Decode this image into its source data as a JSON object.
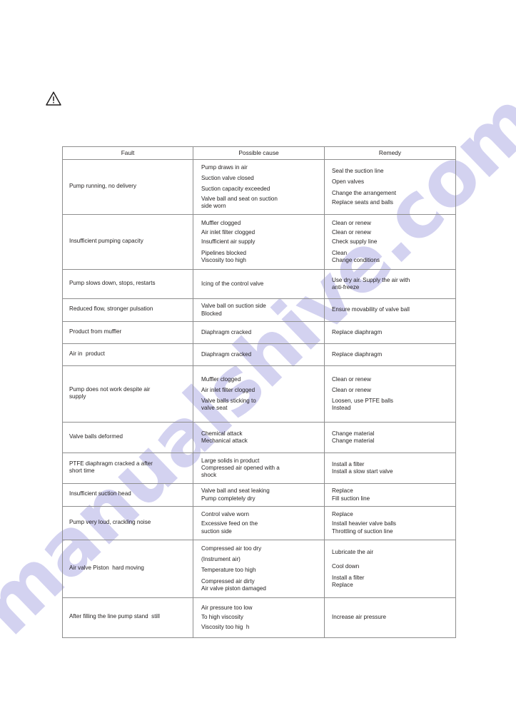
{
  "page": {
    "background_color": "#ffffff",
    "text_color": "#221f1f",
    "border_color": "#8e8e8e"
  },
  "watermark": {
    "text": "manualshive.com",
    "color": "#b9b7e8"
  },
  "warning_icon": {
    "name": "warning-triangle-icon",
    "glyph": "⚠"
  },
  "table": {
    "headers": [
      "Fault",
      "Possible cause",
      "Remedy"
    ],
    "rows": [
      {
        "fault": [
          "Pump running, no delivery"
        ],
        "cause": [
          "Pump draws in air",
          "Suction valve closed",
          "Suction capacity exceeded",
          "Valve ball and seat on suction",
          "side worn"
        ],
        "remedy": [
          "Seal the suction line",
          "Open valves",
          "Change the arrangement",
          "Replace seats and balls"
        ]
      },
      {
        "fault": [
          "Insufficient pumping capacity"
        ],
        "cause": [
          "Muffler clogged",
          "Air inlet filter clogged",
          "Insufficient air supply",
          "Pipelines blocked",
          "Viscosity too high"
        ],
        "remedy": [
          "Clean or renew",
          "Clean or renew",
          "Check supply line",
          "Clean",
          "Change conditions"
        ]
      },
      {
        "fault": [
          "Pump slows down, stops, restarts"
        ],
        "cause": [
          "Icing of the control valve"
        ],
        "remedy": [
          "Use dry air. Supply the air with",
          "anti-freeze"
        ]
      },
      {
        "fault": [
          "Reduced flow, stronger pulsation"
        ],
        "cause": [
          "Valve ball on suction side",
          "Blocked"
        ],
        "remedy": [
          "Ensure movability of valve ball"
        ]
      },
      {
        "fault": [
          "Product from muffler"
        ],
        "cause": [
          "Diaphragm cracked"
        ],
        "remedy": [
          "Replace diaphragm"
        ]
      },
      {
        "fault": [
          "Air in  product"
        ],
        "cause": [
          "Diaphragm cracked"
        ],
        "remedy": [
          "Replace diaphragm"
        ]
      },
      {
        "fault": [
          "Pump does not work despite air",
          "supply"
        ],
        "cause": [
          "Muffler clogged",
          "Air inlet filter clogged",
          "Valve balls sticking to",
          "valve seat"
        ],
        "remedy": [
          "Clean or renew",
          "Clean or renew",
          "Loosen, use PTFE balls",
          "Instead"
        ]
      },
      {
        "fault": [
          "Valve balls deformed"
        ],
        "cause": [
          "Chemical attack",
          "Mechanical attack"
        ],
        "remedy": [
          "Change material",
          "Change material"
        ]
      },
      {
        "fault": [
          "PTFE diaphragm cracked a after",
          "short time"
        ],
        "cause": [
          "Large solids in product",
          "Compressed air opened with a",
          "shock"
        ],
        "remedy": [
          "Install a filter",
          "Install a slow start valve"
        ]
      },
      {
        "fault": [
          "Insufficient suction head"
        ],
        "cause": [
          "Valve ball and seat leaking",
          "Pump completely dry"
        ],
        "remedy": [
          "Replace",
          "Fill suction line"
        ]
      },
      {
        "fault": [
          "Pump very loud, crackling noise"
        ],
        "cause": [
          "Control valve worn",
          "Excessive feed on the",
          "suction side"
        ],
        "remedy": [
          "Replace",
          "Install heavier valve balls",
          "Throttling of suction line"
        ]
      },
      {
        "fault": [
          "Air valve Piston  hard moving"
        ],
        "cause": [
          "Compressed air too dry",
          "(Instrument air)",
          "Temperature too high",
          "Compressed air dirty",
          "Air valve piston damaged"
        ],
        "remedy": [
          "Lubricate the air",
          "",
          "Cool down",
          "Install a filter",
          "Replace"
        ]
      },
      {
        "fault": [
          "After filling the line pump stand  still"
        ],
        "cause": [
          "Air pressure too low",
          "To high viscosity",
          "Viscosity too hig  h"
        ],
        "remedy": [
          "Increase air pressure"
        ]
      }
    ]
  }
}
